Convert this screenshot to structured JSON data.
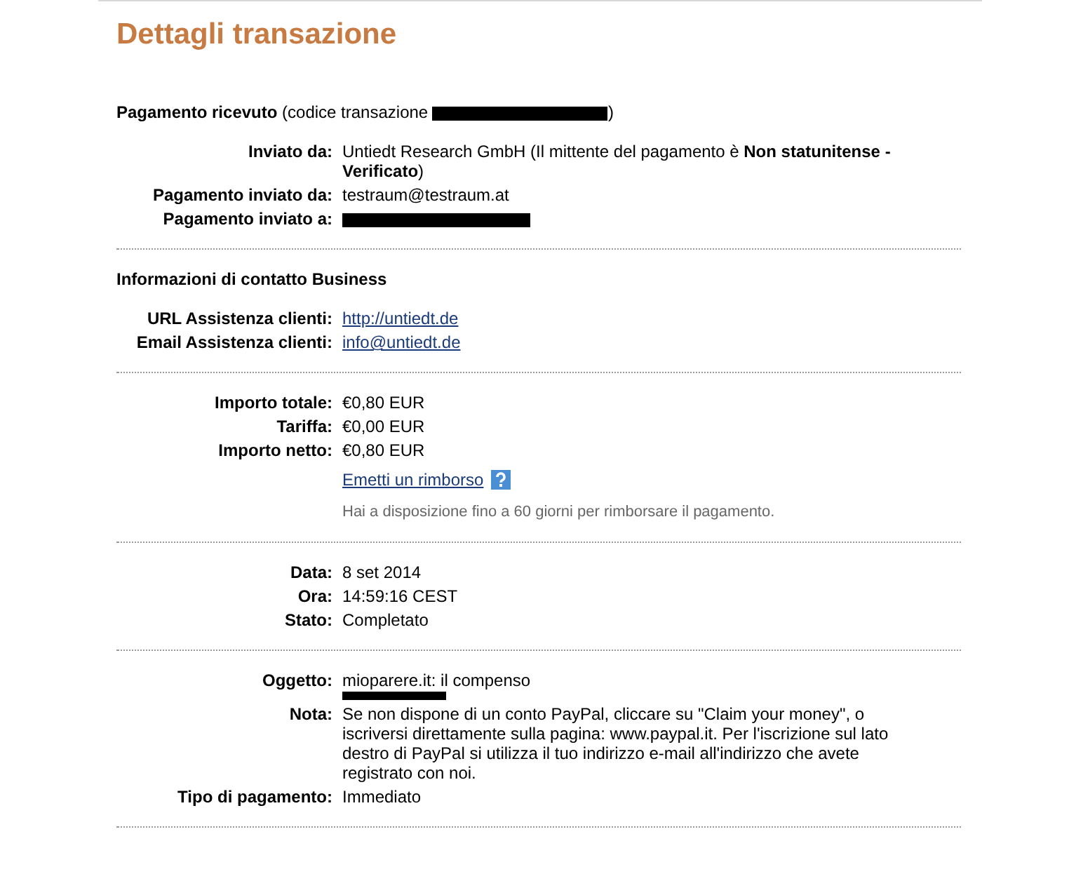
{
  "title": "Dettagli transazione",
  "sections": [
    {
      "heading": "**Pagamento ricevuto** (codice transazione",
      "heading_redacted": true,
      "heading_end": ")",
      "rows": [
        {
          "kind": "text",
          "label": "Inviato da:",
          "value": "Untiedt Research GmbH (Il mittente del pagamento è **Non statunitense - Verificato**)"
        },
        {
          "kind": "text",
          "label": "Pagamento inviato da:",
          "value": "testraum@testraum.at"
        },
        {
          "kind": "redacted",
          "label": "Pagamento inviato a:"
        }
      ]
    },
    {
      "heading": "**Informazioni di contatto Business**",
      "heading_redacted": false,
      "rows": [
        {
          "kind": "link",
          "label": "URL Assistenza clienti:",
          "value": "http://untiedt.de"
        },
        {
          "kind": "link",
          "label": "Email Assistenza clienti:",
          "value": "info@untiedt.de"
        }
      ]
    },
    {
      "rows": [
        {
          "kind": "text",
          "label": "Importo totale:",
          "value": "€0,80 EUR"
        },
        {
          "kind": "text",
          "label": "Tariffa:",
          "value": "€0,00 EUR"
        },
        {
          "kind": "text",
          "label": "Importo netto:",
          "value": "€0,80 EUR"
        },
        {
          "kind": "refund",
          "value": "Emetti un rimborso",
          "note": "Hai a disposizione fino a 60 giorni per rimborsare il pagamento."
        }
      ]
    },
    {
      "rows": [
        {
          "kind": "text",
          "label": "Data:",
          "value": "8 set 2014"
        },
        {
          "kind": "text",
          "label": "Ora:",
          "value": "14:59:16 CEST"
        },
        {
          "kind": "text",
          "label": "Stato:",
          "value": "Completato"
        }
      ]
    },
    {
      "rows": [
        {
          "kind": "partly-redacted",
          "label": "Oggetto:",
          "value": "mioparere.it: il compenso"
        },
        {
          "kind": "text",
          "label": "Nota:",
          "value": "Se non dispone di un conto PayPal, cliccare su \"Claim your money\", o iscriversi direttamente sulla pagina: www.paypal.it. Per l'iscrizione sul lato destro di PayPal si utilizza il tuo indirizzo e-mail all'indirizzo che avete registrato con noi."
        },
        {
          "kind": "text",
          "label": "Tipo di pagamento:",
          "value": "Immediato"
        }
      ]
    }
  ]
}
